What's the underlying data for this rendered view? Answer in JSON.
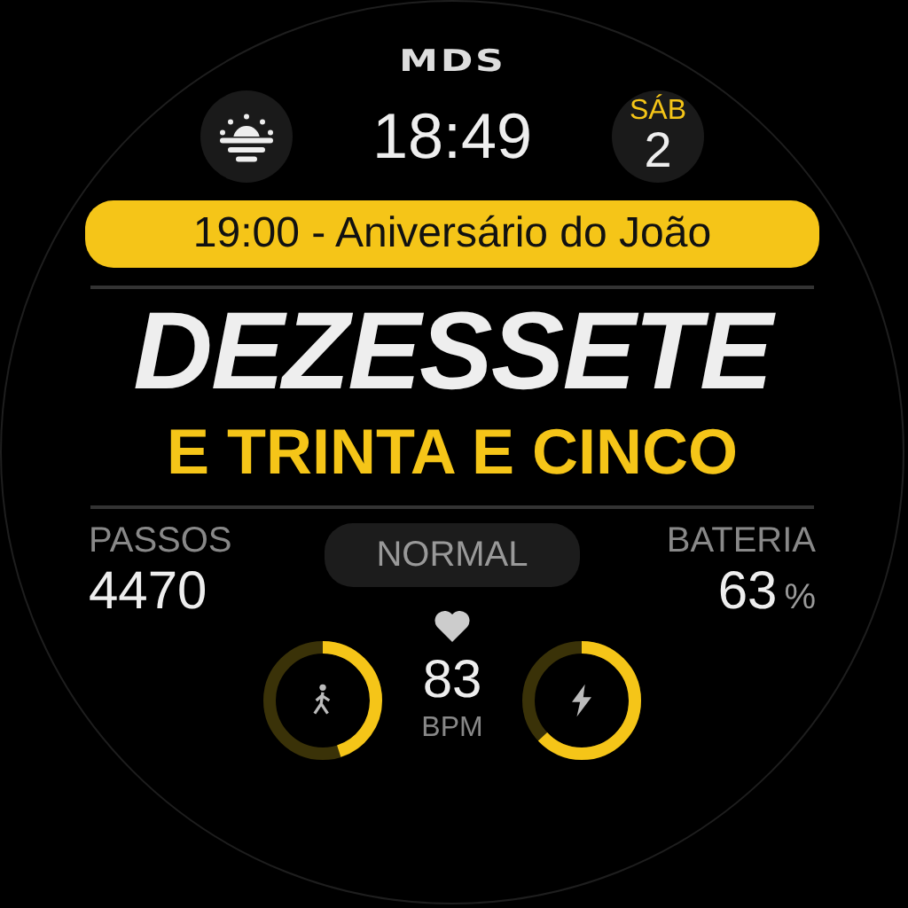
{
  "logo": "MDS",
  "time": "18:49",
  "date": {
    "weekday": "SÁB",
    "day": "2"
  },
  "event": "19:00 - Aniversário do João",
  "hour_words": "DEZESSETE",
  "minute_words": "E TRINTA E CINCO",
  "steps": {
    "label": "PASSOS",
    "value": "4470",
    "level": 0.45
  },
  "mode": "NORMAL",
  "battery": {
    "label": "BATERIA",
    "value": "63",
    "unit": "%",
    "level": 0.63
  },
  "heart": {
    "value": "83",
    "unit": "BPM"
  }
}
